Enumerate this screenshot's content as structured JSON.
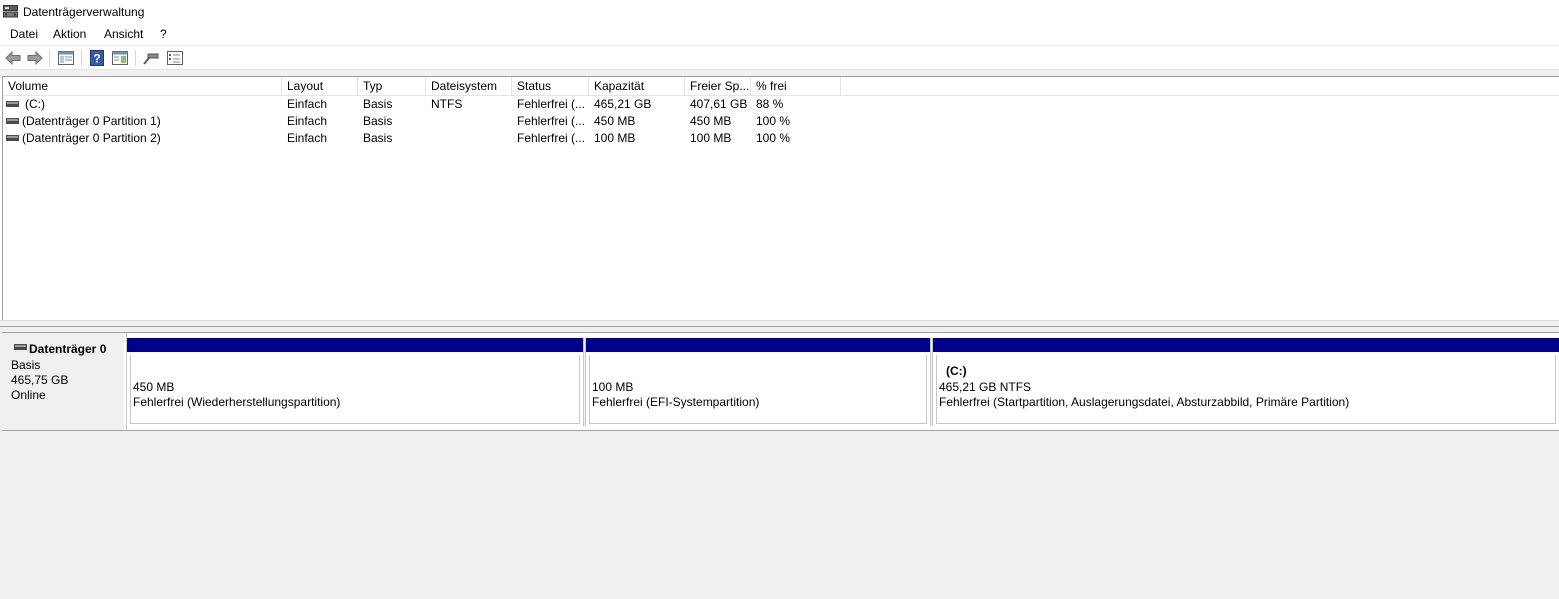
{
  "window": {
    "title": "Datenträgerverwaltung",
    "icon": "disk-management-icon"
  },
  "menu": {
    "items": [
      "Datei",
      "Aktion",
      "Ansicht",
      "?"
    ]
  },
  "toolbar": {
    "buttons": [
      "back-icon",
      "forward-icon",
      "console-tree-icon",
      "help-icon",
      "action-pane-icon",
      "connect-icon",
      "properties-icon"
    ]
  },
  "volume_list": {
    "columns": [
      "Volume",
      "Layout",
      "Typ",
      "Dateisystem",
      "Status",
      "Kapazität",
      "Freier Sp...",
      "% frei"
    ],
    "rows": [
      {
        "volume": "(C:)",
        "layout": "Einfach",
        "type": "Basis",
        "fs": "NTFS",
        "status": "Fehlerfrei (...",
        "capacity": "465,21 GB",
        "free": "407,61 GB",
        "pct": "88 %"
      },
      {
        "volume": "(Datenträger 0 Partition 1)",
        "layout": "Einfach",
        "type": "Basis",
        "fs": "",
        "status": "Fehlerfrei (...",
        "capacity": "450 MB",
        "free": "450 MB",
        "pct": "100 %"
      },
      {
        "volume": "(Datenträger 0 Partition 2)",
        "layout": "Einfach",
        "type": "Basis",
        "fs": "",
        "status": "Fehlerfrei (...",
        "capacity": "100 MB",
        "free": "100 MB",
        "pct": "100 %"
      }
    ]
  },
  "disk": {
    "name": "Datenträger 0",
    "type": "Basis",
    "size": "465,75 GB",
    "state": "Online",
    "bar_color": "#00008b",
    "partitions": [
      {
        "title": "",
        "size": "450 MB",
        "status": "Fehlerfrei (Wiederherstellungspartition)"
      },
      {
        "title": "",
        "size": "100 MB",
        "status": "Fehlerfrei (EFI-Systempartition)"
      },
      {
        "title": "(C:)",
        "size": "465,21 GB NTFS",
        "status": "Fehlerfrei (Startpartition, Auslagerungsdatei, Absturzabbild, Primäre Partition)"
      }
    ]
  }
}
